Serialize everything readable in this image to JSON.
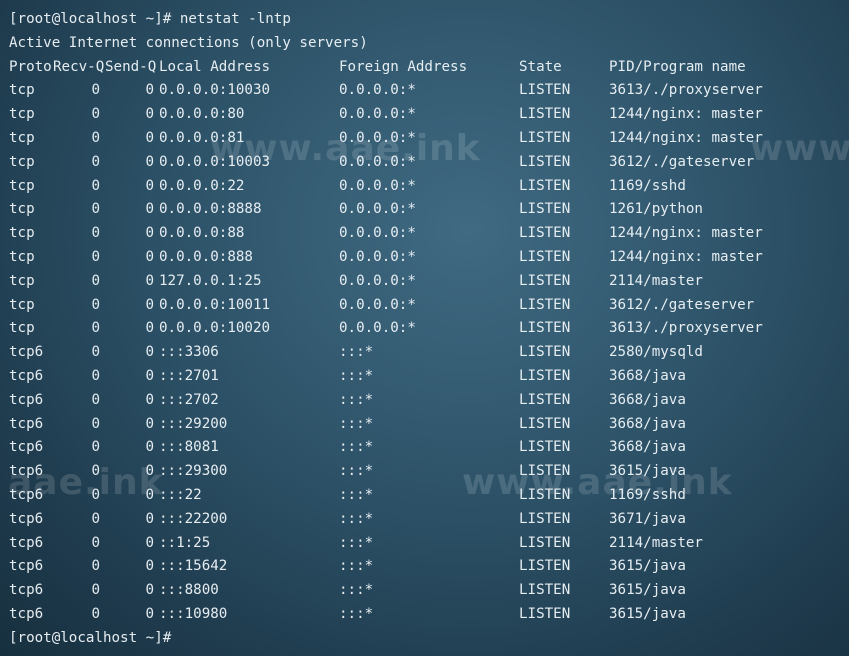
{
  "prompt_command": "[root@localhost ~]# netstat -lntp",
  "title_line": "Active Internet connections (only servers)",
  "headers": {
    "proto": "Proto",
    "recv": "Recv-Q",
    "send": "Send-Q",
    "local": "Local Address",
    "foreign": "Foreign Address",
    "state": "State",
    "pid": "PID/Program name"
  },
  "rows": [
    {
      "proto": "tcp",
      "recv": "0",
      "send": "0",
      "local": "0.0.0.0:10030",
      "foreign": "0.0.0.0:*",
      "state": "LISTEN",
      "pid": "3613/./proxyserver"
    },
    {
      "proto": "tcp",
      "recv": "0",
      "send": "0",
      "local": "0.0.0.0:80",
      "foreign": "0.0.0.0:*",
      "state": "LISTEN",
      "pid": "1244/nginx: master"
    },
    {
      "proto": "tcp",
      "recv": "0",
      "send": "0",
      "local": "0.0.0.0:81",
      "foreign": "0.0.0.0:*",
      "state": "LISTEN",
      "pid": "1244/nginx: master"
    },
    {
      "proto": "tcp",
      "recv": "0",
      "send": "0",
      "local": "0.0.0.0:10003",
      "foreign": "0.0.0.0:*",
      "state": "LISTEN",
      "pid": "3612/./gateserver"
    },
    {
      "proto": "tcp",
      "recv": "0",
      "send": "0",
      "local": "0.0.0.0:22",
      "foreign": "0.0.0.0:*",
      "state": "LISTEN",
      "pid": "1169/sshd"
    },
    {
      "proto": "tcp",
      "recv": "0",
      "send": "0",
      "local": "0.0.0.0:8888",
      "foreign": "0.0.0.0:*",
      "state": "LISTEN",
      "pid": "1261/python"
    },
    {
      "proto": "tcp",
      "recv": "0",
      "send": "0",
      "local": "0.0.0.0:88",
      "foreign": "0.0.0.0:*",
      "state": "LISTEN",
      "pid": "1244/nginx: master"
    },
    {
      "proto": "tcp",
      "recv": "0",
      "send": "0",
      "local": "0.0.0.0:888",
      "foreign": "0.0.0.0:*",
      "state": "LISTEN",
      "pid": "1244/nginx: master"
    },
    {
      "proto": "tcp",
      "recv": "0",
      "send": "0",
      "local": "127.0.0.1:25",
      "foreign": "0.0.0.0:*",
      "state": "LISTEN",
      "pid": "2114/master"
    },
    {
      "proto": "tcp",
      "recv": "0",
      "send": "0",
      "local": "0.0.0.0:10011",
      "foreign": "0.0.0.0:*",
      "state": "LISTEN",
      "pid": "3612/./gateserver"
    },
    {
      "proto": "tcp",
      "recv": "0",
      "send": "0",
      "local": "0.0.0.0:10020",
      "foreign": "0.0.0.0:*",
      "state": "LISTEN",
      "pid": "3613/./proxyserver"
    },
    {
      "proto": "tcp6",
      "recv": "0",
      "send": "0",
      "local": ":::3306",
      "foreign": ":::*",
      "state": "LISTEN",
      "pid": "2580/mysqld"
    },
    {
      "proto": "tcp6",
      "recv": "0",
      "send": "0",
      "local": ":::2701",
      "foreign": ":::*",
      "state": "LISTEN",
      "pid": "3668/java"
    },
    {
      "proto": "tcp6",
      "recv": "0",
      "send": "0",
      "local": ":::2702",
      "foreign": ":::*",
      "state": "LISTEN",
      "pid": "3668/java"
    },
    {
      "proto": "tcp6",
      "recv": "0",
      "send": "0",
      "local": ":::29200",
      "foreign": ":::*",
      "state": "LISTEN",
      "pid": "3668/java"
    },
    {
      "proto": "tcp6",
      "recv": "0",
      "send": "0",
      "local": ":::8081",
      "foreign": ":::*",
      "state": "LISTEN",
      "pid": "3668/java"
    },
    {
      "proto": "tcp6",
      "recv": "0",
      "send": "0",
      "local": ":::29300",
      "foreign": ":::*",
      "state": "LISTEN",
      "pid": "3615/java"
    },
    {
      "proto": "tcp6",
      "recv": "0",
      "send": "0",
      "local": ":::22",
      "foreign": ":::*",
      "state": "LISTEN",
      "pid": "1169/sshd"
    },
    {
      "proto": "tcp6",
      "recv": "0",
      "send": "0",
      "local": ":::22200",
      "foreign": ":::*",
      "state": "LISTEN",
      "pid": "3671/java"
    },
    {
      "proto": "tcp6",
      "recv": "0",
      "send": "0",
      "local": "::1:25",
      "foreign": ":::*",
      "state": "LISTEN",
      "pid": "2114/master"
    },
    {
      "proto": "tcp6",
      "recv": "0",
      "send": "0",
      "local": ":::15642",
      "foreign": ":::*",
      "state": "LISTEN",
      "pid": "3615/java"
    },
    {
      "proto": "tcp6",
      "recv": "0",
      "send": "0",
      "local": ":::8800",
      "foreign": ":::*",
      "state": "LISTEN",
      "pid": "3615/java"
    },
    {
      "proto": "tcp6",
      "recv": "0",
      "send": "0",
      "local": ":::10980",
      "foreign": ":::*",
      "state": "LISTEN",
      "pid": "3615/java"
    }
  ],
  "final_prompt": "[root@localhost ~]#",
  "watermarks": [
    "www.aae.ink",
    "www",
    "aae.ink",
    "www.aae.ink"
  ],
  "colors": {
    "text": "#e6edf1",
    "background": "#2d5268"
  }
}
